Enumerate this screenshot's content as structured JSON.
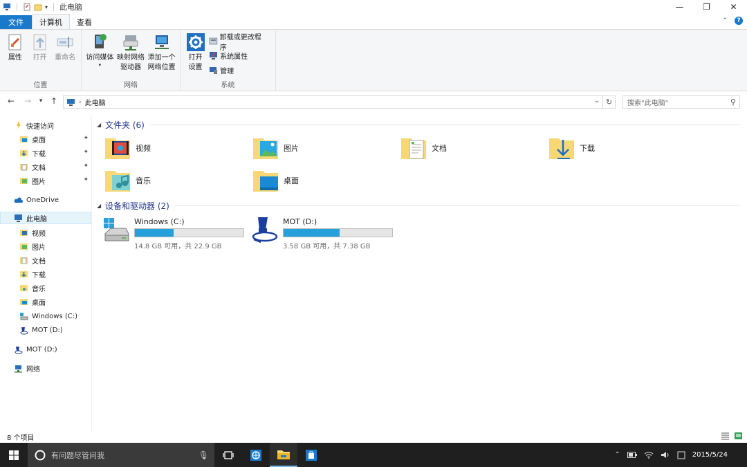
{
  "window": {
    "title": "此电脑",
    "controls": {
      "minimize": "—",
      "restore": "❐",
      "close": "✕"
    }
  },
  "ribbon": {
    "tabs": [
      {
        "label": "文件"
      },
      {
        "label": "计算机"
      },
      {
        "label": "查看"
      }
    ],
    "groups": {
      "location": {
        "label": "位置",
        "buttons": [
          {
            "label": "属性",
            "icon": "properties-icon"
          },
          {
            "label": "打开",
            "icon": "open-icon"
          },
          {
            "label": "重命名",
            "icon": "rename-icon"
          }
        ]
      },
      "network": {
        "label": "网络",
        "buttons": [
          {
            "label": "访问媒体",
            "icon": "media-access-icon"
          },
          {
            "label": "映射网络驱动器",
            "line1": "映射网络",
            "line2": "驱动器",
            "icon": "map-drive-icon"
          },
          {
            "label": "添加一个网络位置",
            "line1": "添加一个",
            "line2": "网络位置",
            "icon": "add-network-location-icon"
          }
        ]
      },
      "system": {
        "label": "系统",
        "open_settings": {
          "line1": "打开",
          "line2": "设置"
        },
        "small": [
          {
            "label": "卸载或更改程序"
          },
          {
            "label": "系统属性"
          },
          {
            "label": "管理"
          }
        ]
      }
    }
  },
  "address": {
    "path": "此电脑",
    "search_placeholder": "搜索\"此电脑\""
  },
  "navpane": {
    "quick_access": "快速访问",
    "quick_items": [
      "桌面",
      "下载",
      "文档",
      "图片"
    ],
    "onedrive": "OneDrive",
    "this_pc": "此电脑",
    "pc_items": [
      "视频",
      "图片",
      "文档",
      "下载",
      "音乐",
      "桌面",
      "Windows (C:)",
      "MOT (D:)"
    ],
    "mot_drive": "MOT (D:)",
    "network": "网络"
  },
  "content": {
    "folders_header": "文件夹 (6)",
    "folders": [
      "视频",
      "图片",
      "文档",
      "下载",
      "音乐",
      "桌面"
    ],
    "drives_header": "设备和驱动器 (2)",
    "drives": [
      {
        "name": "Windows (C:)",
        "info": "14.8 GB 可用，共 22.9 GB",
        "used_fraction": 0.354
      },
      {
        "name": "MOT (D:)",
        "info": "3.58 GB 可用，共 7.38 GB",
        "used_fraction": 0.515
      }
    ]
  },
  "status": {
    "item_count": "8 个项目"
  },
  "taskbar": {
    "search_placeholder": "有问题尽管问我",
    "clock_time": "",
    "clock_date": "2015/5/24",
    "accent": "#76b9ed"
  }
}
